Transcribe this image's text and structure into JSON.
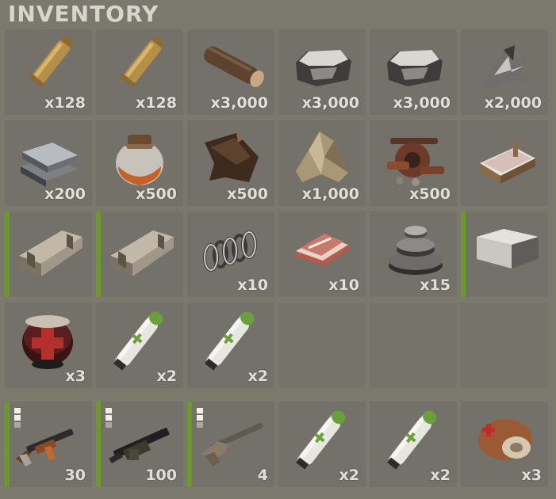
{
  "title": "INVENTORY",
  "rows": [
    [
      {
        "item": "rifle-ammo-icon",
        "qty": "x128"
      },
      {
        "item": "rifle-ammo-icon",
        "qty": "x128"
      },
      {
        "item": "wood-icon",
        "qty": "x3,000"
      },
      {
        "item": "stones-icon",
        "qty": "x3,000"
      },
      {
        "item": "stones-icon",
        "qty": "x3,000"
      },
      {
        "item": "metal-fragments-icon",
        "qty": "x2,000"
      }
    ],
    [
      {
        "item": "metal-ingots-icon",
        "qty": "x200"
      },
      {
        "item": "low-grade-fuel-jar-icon",
        "qty": "x500"
      },
      {
        "item": "leather-icon",
        "qty": "x500"
      },
      {
        "item": "cloth-icon",
        "qty": "x1,000"
      },
      {
        "item": "scrap-parts-icon",
        "qty": "x500"
      },
      {
        "item": "bed-icon",
        "qty": ""
      }
    ],
    [
      {
        "item": "wooden-crate-icon",
        "qty": "",
        "equipped": true
      },
      {
        "item": "wooden-crate-icon",
        "qty": "",
        "equipped": true
      },
      {
        "item": "spring-icon",
        "qty": "x10"
      },
      {
        "item": "metal-sheets-icon",
        "qty": "x10"
      },
      {
        "item": "gears-icon",
        "qty": "x15"
      },
      {
        "item": "large-box-icon",
        "qty": "",
        "equipped": true
      }
    ],
    [
      {
        "item": "medical-helmet-icon",
        "qty": "x3"
      },
      {
        "item": "medical-syringe-icon",
        "qty": "x2"
      },
      {
        "item": "medical-syringe-icon",
        "qty": "x2"
      },
      {
        "item": "empty",
        "qty": ""
      },
      {
        "item": "empty",
        "qty": ""
      },
      {
        "item": "empty",
        "qty": ""
      }
    ],
    [
      {
        "item": "assault-rifle-icon",
        "qty": "30",
        "equipped": true,
        "condition": true
      },
      {
        "item": "machine-gun-icon",
        "qty": "100",
        "equipped": true,
        "condition": true
      },
      {
        "item": "bolt-action-rifle-icon",
        "qty": "4",
        "equipped": true,
        "condition": true
      },
      {
        "item": "medical-syringe-icon",
        "qty": "x2"
      },
      {
        "item": "medical-syringe-icon",
        "qty": "x2"
      },
      {
        "item": "bandage-roll-icon",
        "qty": "x3"
      }
    ]
  ],
  "colors": {
    "accent_green": "#6b9a2b",
    "slot_bg": "#74716a",
    "panel_bg": "#7b786e"
  }
}
